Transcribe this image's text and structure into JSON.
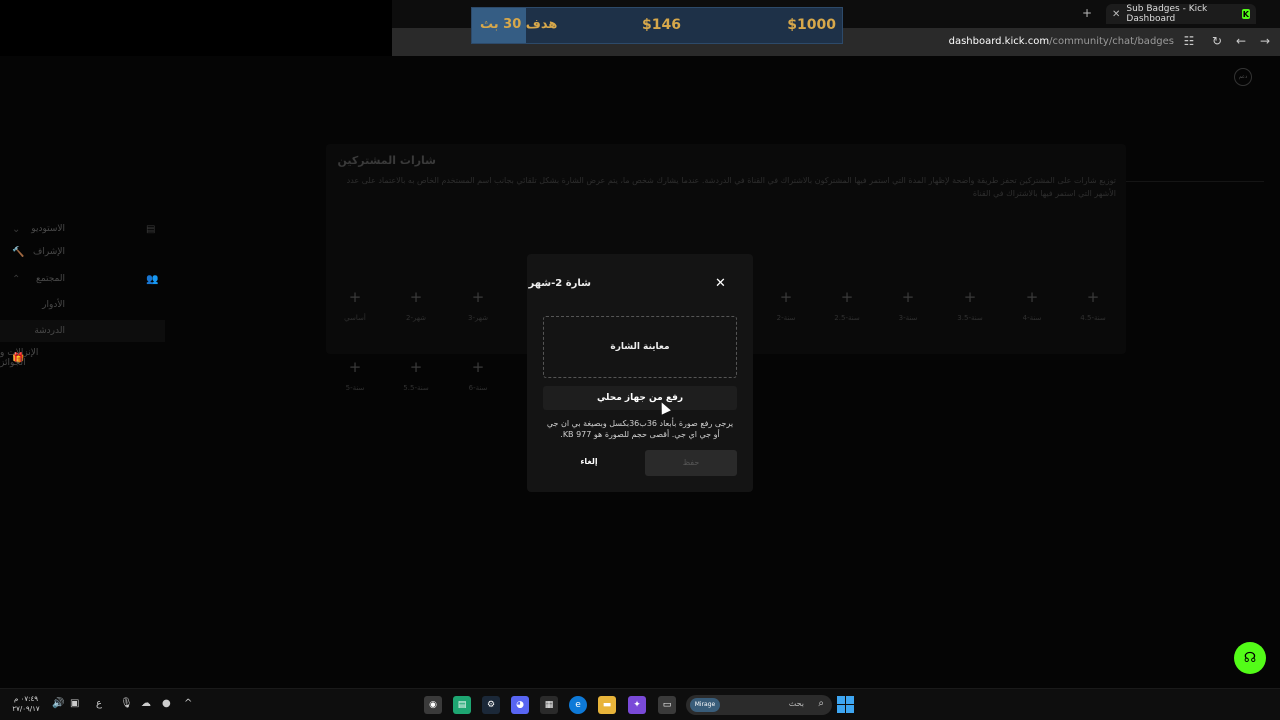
{
  "browser": {
    "tab_title": "Sub Badges - Kick Dashboard",
    "tab_close": "✕",
    "new_tab": "+",
    "favicon": "K",
    "url_domain": "dashboard.kick.com",
    "url_path": "/community/chat/badges",
    "icons": [
      "tune-icon",
      "reload-icon",
      "back-icon",
      "forward-icon"
    ]
  },
  "donation": {
    "goal_label": "هدف 30 بث",
    "current": "$146",
    "target": "$1000",
    "progress": 0.146,
    "colors": {
      "bar": "#1e3148",
      "fill": "#355d84",
      "text": "#d7a84b"
    }
  },
  "avatar_text": "دعم",
  "sidebar": {
    "items": [
      {
        "label": "الاستوديو",
        "chevron": "⌄",
        "icon": "▤"
      },
      {
        "label": "الإشراف",
        "icon": "🔨"
      },
      {
        "label": "المجتمع",
        "chevron": "⌃",
        "icon": "👥"
      },
      {
        "label": "الأدوار"
      },
      {
        "label": "الدردشة"
      },
      {
        "label": "الإنزالات و الجوائز",
        "icon": "🎁"
      }
    ]
  },
  "panel": {
    "title": "شارات المشتركين",
    "description": "توزيع شارات على المشتركين تحفز طريقة واضحة لإظهار المدة التي استمر فيها المشتركون بالاشتراك في القناة في الدردشة. عندما يشارك شخص ما، يتم عرض الشارة بشكل تلقائي بجانب اسم المستخدم الخاص به بالاعتماد على عدد الأشهر التي استمر فيها بالاشتراك في القناة",
    "slots_row1": [
      "أساسي",
      "شهر-2",
      "شهر-3",
      "",
      "",
      "",
      "",
      "سنة-2",
      "سنة-2.5",
      "سنة-3",
      "سنة-3.5",
      "سنة-4",
      "سنة-4.5"
    ],
    "slots_row2": [
      "سنة-5",
      "سنة-5.5",
      "سنة-6"
    ]
  },
  "modal": {
    "title": "شارة 2-شهر",
    "close": "✕",
    "preview_label": "معاينة الشارة",
    "upload_label": "رفع من جهاز محلي",
    "help_text": "يرجى رفع صورة بأبعاد 36ب36بكسل وبصيغة بي ان جي أو جي اي جي. أقصى حجم للصورة هو 977 KB.",
    "cancel_label": "إلغاء",
    "save_label": "حفظ"
  },
  "support_icon": "headset-icon",
  "taskbar": {
    "time": "٠٧:٤٩ م",
    "date": "٢٧/٠٩/١٧",
    "lang": "ع",
    "search_text": "بحث",
    "search_art": "Mirage"
  }
}
